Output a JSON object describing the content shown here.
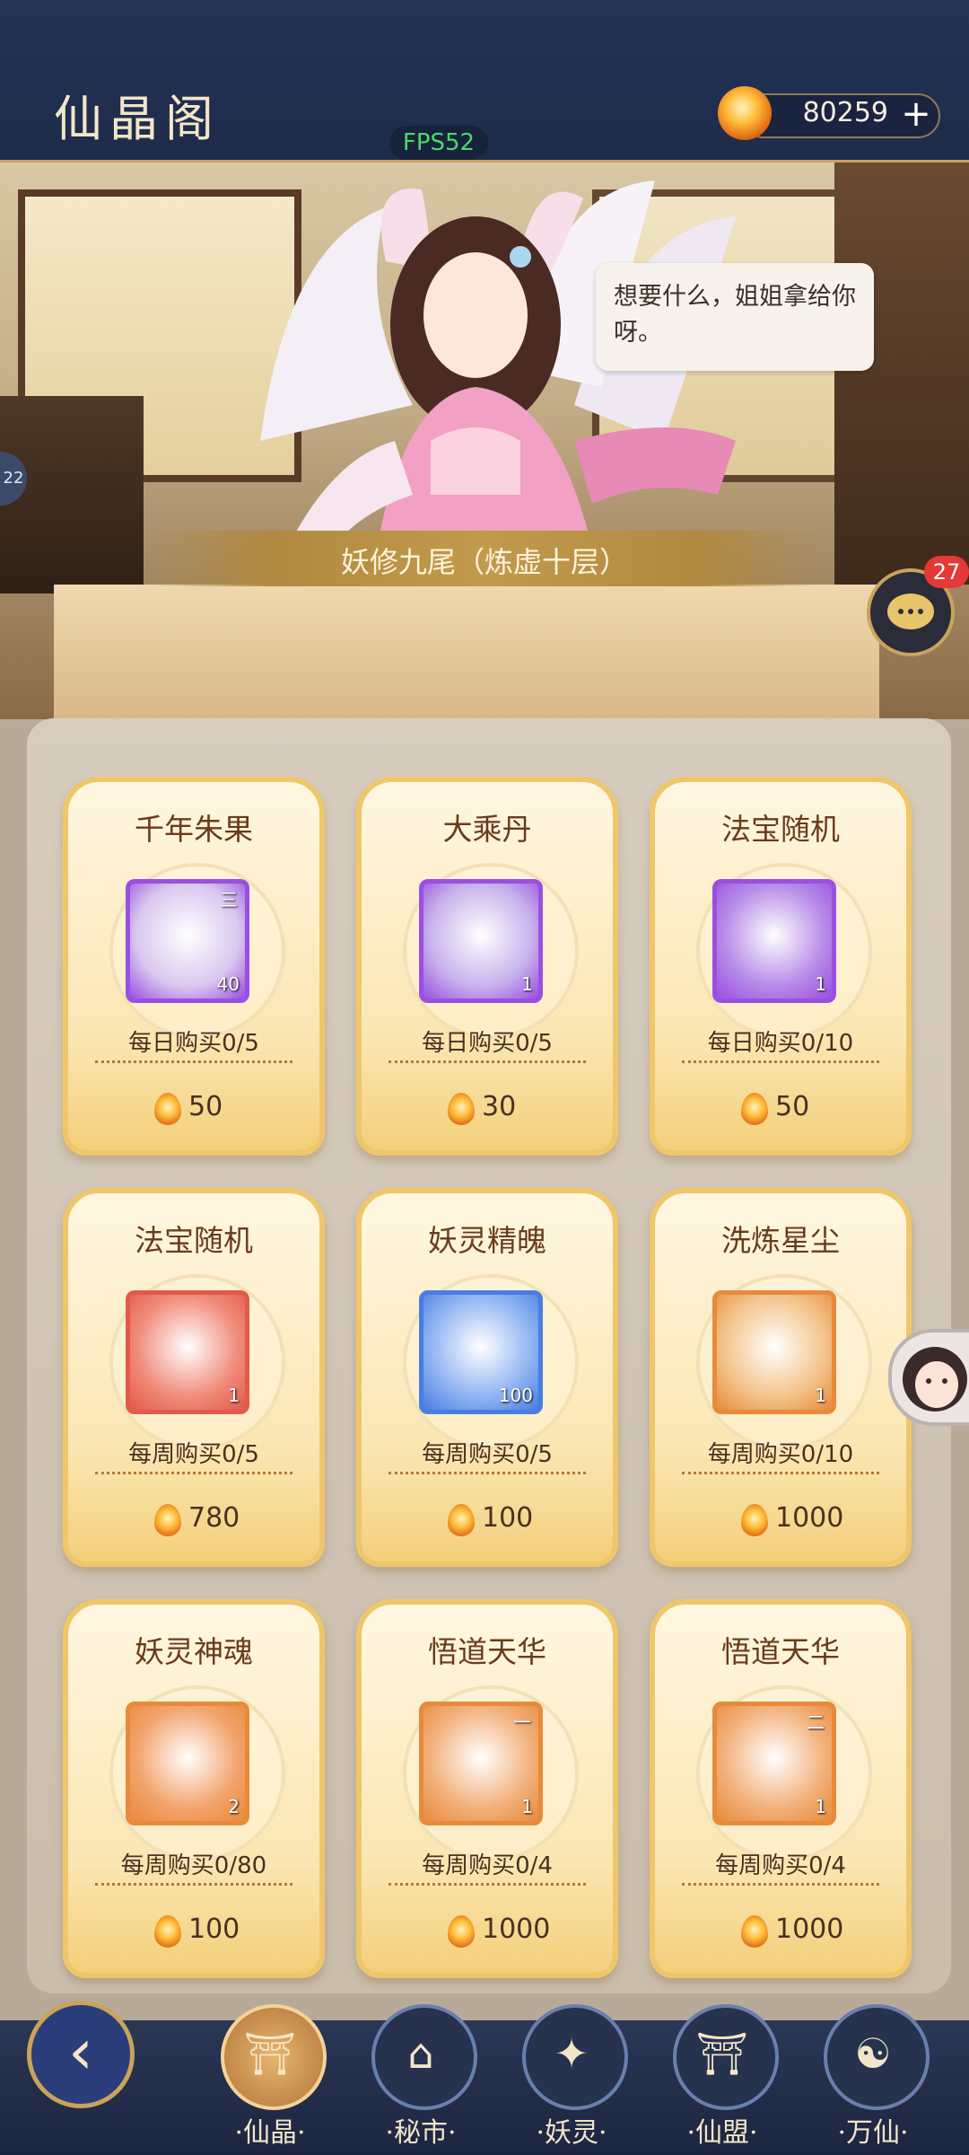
{
  "header": {
    "title": "仙晶阁",
    "fps": "FPS52",
    "currency_value": "80259",
    "currency_plus": "+"
  },
  "scene": {
    "speech": "想要什么，姐姐拿给你呀。",
    "npc_name": "妖修九尾（炼虚十层）",
    "chat_badge": "27",
    "side_tab": "22"
  },
  "shop_items": [
    {
      "name": "千年朱果",
      "count": "40",
      "grade": "三",
      "limit": "每日购买0/5",
      "price": "50",
      "frame": "#9b4fe0",
      "bg": "#d9c8ef"
    },
    {
      "name": "大乘丹",
      "count": "1",
      "grade": "",
      "limit": "每日购买0/5",
      "price": "30",
      "frame": "#9b4fe0",
      "bg": "#c7b2ec"
    },
    {
      "name": "法宝随机",
      "count": "1",
      "grade": "",
      "limit": "每日购买0/10",
      "price": "50",
      "frame": "#9b4fe0",
      "bg": "#b78ae8"
    },
    {
      "name": "法宝随机",
      "count": "1",
      "grade": "",
      "limit": "每周购买0/5",
      "price": "780",
      "frame": "#e25a4a",
      "bg": "#f08b7a"
    },
    {
      "name": "妖灵精魄",
      "count": "100",
      "grade": "",
      "limit": "每周购买0/5",
      "price": "100",
      "frame": "#4a7de2",
      "bg": "#8fb3f2"
    },
    {
      "name": "洗炼星尘",
      "count": "1",
      "grade": "",
      "limit": "每周购买0/10",
      "price": "1000",
      "frame": "#e88a3c",
      "bg": "#f3c38a"
    },
    {
      "name": "妖灵神魂",
      "count": "2",
      "grade": "",
      "limit": "每周购买0/80",
      "price": "100",
      "frame": "#e88a3c",
      "bg": "#f2a36b"
    },
    {
      "name": "悟道天华",
      "count": "1",
      "grade": "一",
      "limit": "每周购买0/4",
      "price": "1000",
      "frame": "#e88a3c",
      "bg": "#f2b07a"
    },
    {
      "name": "悟道天华",
      "count": "1",
      "grade": "二",
      "limit": "每周购买0/4",
      "price": "1000",
      "frame": "#e88a3c",
      "bg": "#f2b07a"
    }
  ],
  "nav": [
    {
      "label": "仙晶",
      "icon": "shop-pavilion-icon",
      "active": true
    },
    {
      "label": "秘市",
      "icon": "secret-market-icon",
      "active": false
    },
    {
      "label": "妖灵",
      "icon": "fox-spirit-icon",
      "active": false
    },
    {
      "label": "仙盟",
      "icon": "alliance-gate-icon",
      "active": false
    },
    {
      "label": "万仙",
      "icon": "immortal-icon",
      "active": false
    }
  ]
}
